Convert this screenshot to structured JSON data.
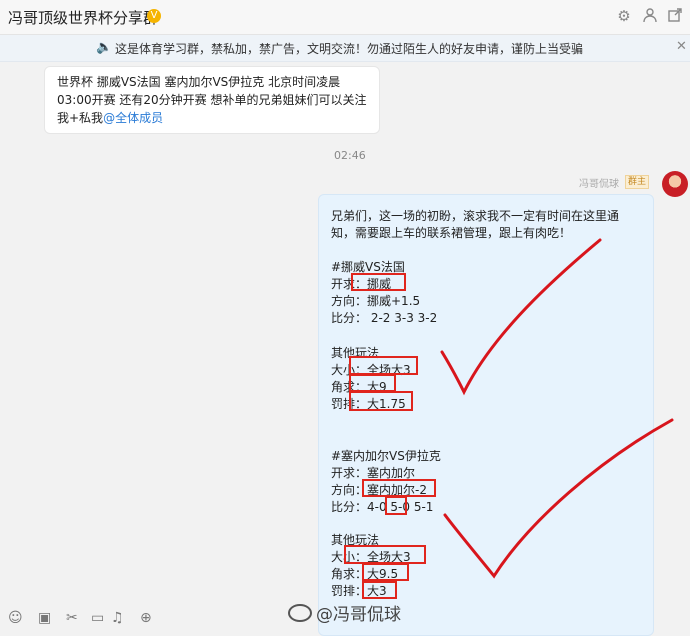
{
  "header": {
    "title": "冯哥顶级世界杯分享群",
    "verified_badge": "V",
    "icons": [
      "gear-icon",
      "user-icon",
      "share-icon"
    ]
  },
  "notice": {
    "text": "这是体育学习群，禁私加，禁广告，文明交流！勿通过陌生人的好友申请，谨防上当受骗"
  },
  "message1": {
    "lines": [
      "世界杯 挪威VS法国 塞内加尔VS伊拉克 北京时间凌晨",
      "03:00开赛 还有20分钟开赛 想补单的兄弟姐妹们可以关注",
      "我+私我"
    ],
    "mention": "@全体成员"
  },
  "timestamp": "02:46",
  "message2": {
    "sender": "冯哥侃球",
    "role": "群主",
    "intro": [
      "兄弟们，这一场的初盼，滚求我不一定有时间在这里通",
      "知，需要跟上车的联系裙管理，跟上有肉吃！"
    ],
    "match1": {
      "title": "#挪威VS法国",
      "kickoff_label": "开求",
      "kickoff_value": "：挪威",
      "direction": "方向：挪威+1.5",
      "score": "比分：  2-2 3-3 3-2",
      "other_title": "其他玩法",
      "size_label": "大小",
      "size_value": "：全场大3",
      "corner_label": "角求",
      "corner_value": "：大9",
      "penalty_label": "罚排",
      "penalty_value": "：大1.75"
    },
    "match2": {
      "title": "#塞内加尔VS伊拉克",
      "kickoff": "开求：塞内加尔",
      "direction_label": "方向",
      "direction_value": "：塞内加尔-2",
      "score": "比分：4-0 5-0 5-1",
      "other_title": "其他玩法",
      "size_label": "大小",
      "size_value": "：全场大3",
      "corner_label": "角求",
      "corner_value": "：大9.5",
      "penalty_label": "罚排",
      "penalty_value": "：大3"
    }
  },
  "watermark": "@冯哥侃球"
}
